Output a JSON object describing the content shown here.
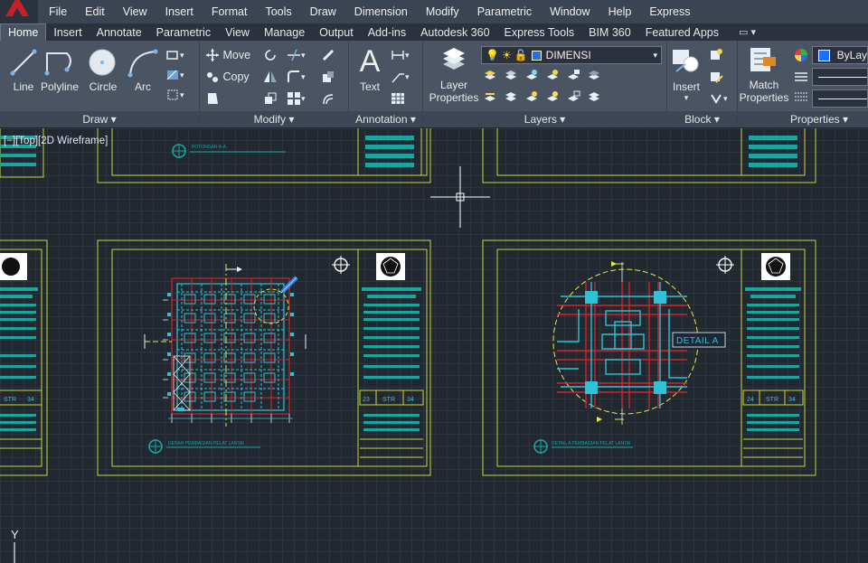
{
  "menu": [
    "File",
    "Edit",
    "View",
    "Insert",
    "Format",
    "Tools",
    "Draw",
    "Dimension",
    "Modify",
    "Parametric",
    "Window",
    "Help",
    "Express"
  ],
  "tabs": [
    "Home",
    "Insert",
    "Annotate",
    "Parametric",
    "View",
    "Manage",
    "Output",
    "Add-ins",
    "Autodesk 360",
    "Express Tools",
    "BIM 360",
    "Featured Apps"
  ],
  "active_tab": "Home",
  "ribbon": {
    "draw": {
      "title": "Draw",
      "line": "Line",
      "polyline": "Polyline",
      "circle": "Circle",
      "arc": "Arc"
    },
    "modify": {
      "title": "Modify",
      "move": "Move",
      "copy": "Copy"
    },
    "annotation": {
      "title": "Annotation",
      "text": "Text"
    },
    "layers": {
      "title": "Layers",
      "layer_properties_1": "Layer",
      "layer_properties_2": "Properties",
      "current_layer": "DIMENSI"
    },
    "block": {
      "title": "Block",
      "insert": "Insert"
    },
    "properties": {
      "title": "Properties",
      "match_1": "Match",
      "match_2": "Properties",
      "color_value": "ByLay"
    }
  },
  "viewport": {
    "label": "[−][Top][2D Wireframe]"
  },
  "drawing": {
    "callout": "DETAIL A",
    "title_left": "DENAH PEMBAGIAN PELAT LANTAI",
    "title_right": "DETAIL A PEMBAGIAN PELAT LANTAI",
    "title_top": "POTONGAN A-A",
    "sheet_left": "23",
    "sheet_mid": "STR",
    "sheet_right": "34",
    "sheet_right_2": "24",
    "sheet_edge_mid": "STR",
    "sheet_edge_right": "34",
    "ucs_y": "Y"
  },
  "colors": {
    "frame": "#c8d43a",
    "cyan": "#2ec2d6",
    "red": "#d0242c",
    "teal": "#1aa59e",
    "yellow": "#e8e84a"
  }
}
